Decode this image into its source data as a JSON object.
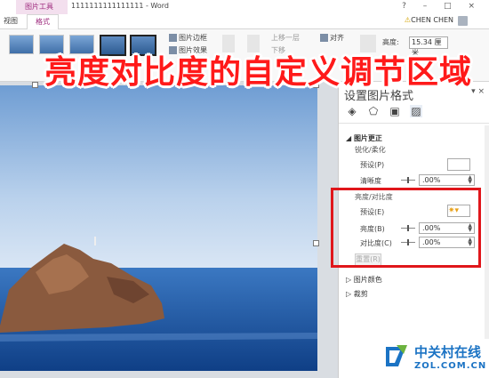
{
  "titlebar": {
    "context_group": "图片工具",
    "doc_title": "1111111111111111 - Word",
    "window_buttons": "? – □ ×"
  },
  "tabs": {
    "view": "视图",
    "format": "格式"
  },
  "user": {
    "warn": "⚠",
    "name": "CHEN CHEN"
  },
  "ribbon": {
    "border": "图片边框",
    "effects": "图片效果",
    "bring_forward": "上移一层",
    "send_backward": "下移",
    "align": "对齐",
    "height_label": "高度:",
    "height_value": "15.34 厘米"
  },
  "banner": "亮度对比度的自定义调节区域",
  "pane": {
    "title": "设置图片格式",
    "section_correction": "图片更正",
    "sharpen_heading": "锐化/柔化",
    "preset_label": "预设(P)",
    "clarity_label": "清晰度",
    "clarity_value": ".00%",
    "bright_contrast_heading": "亮度/对比度",
    "preset2_label": "预设(E)",
    "brightness_label": "亮度(B)",
    "brightness_value": ".00%",
    "contrast_label": "对比度(C)",
    "contrast_value": ".00%",
    "reset_label": "重置(R)",
    "section_color": "图片颜色",
    "section_crop": "裁剪"
  },
  "watermark": {
    "cn": "中关村在线",
    "en": "ZOL.COM.CN"
  },
  "colors": {
    "accent": "#9e2a7d",
    "banner": "#ff1a1a",
    "highlight_box": "#e0161b",
    "watermark": "#1b73c4"
  }
}
